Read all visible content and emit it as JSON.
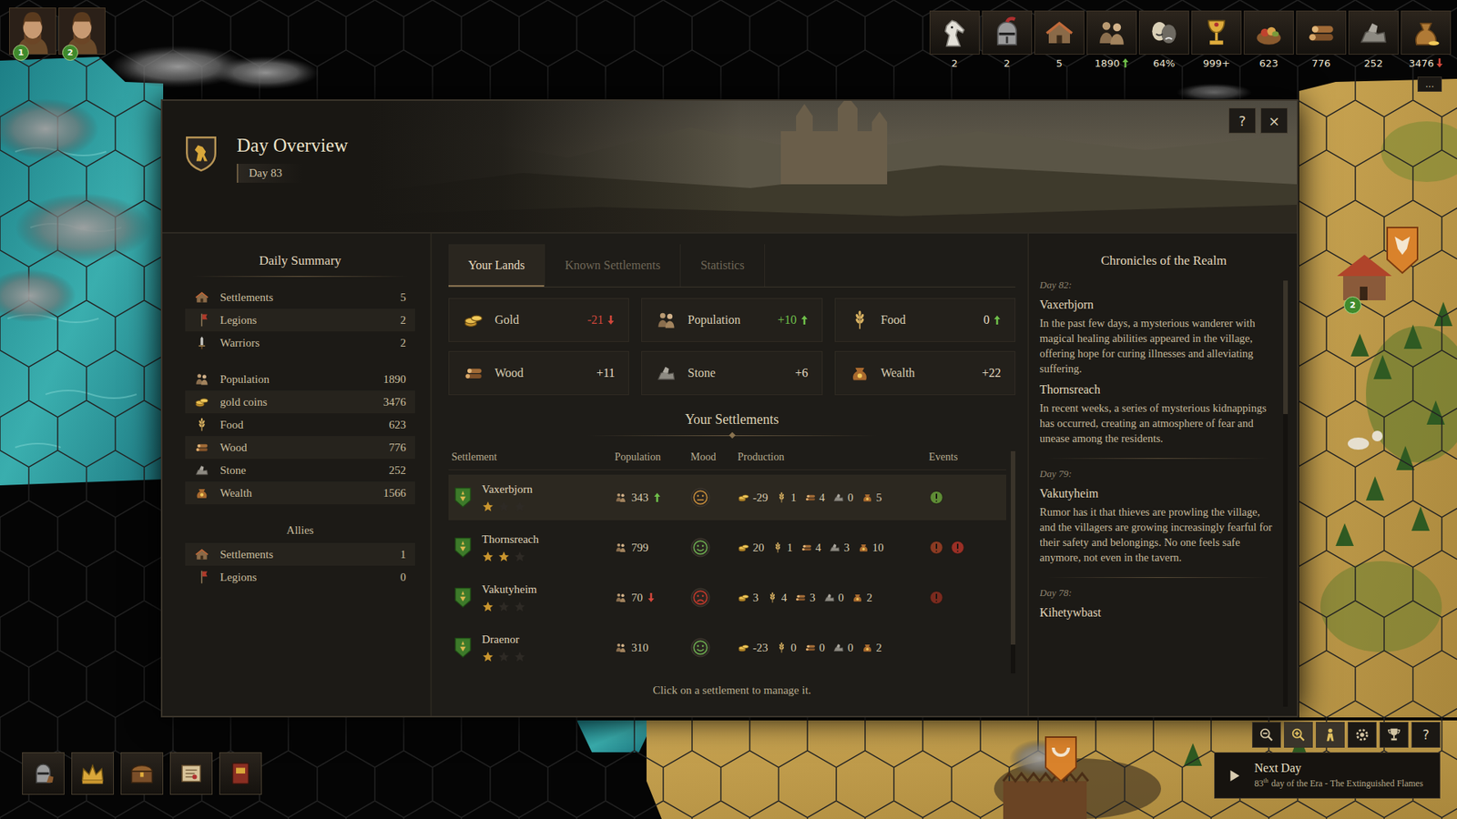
{
  "portraits": [
    {
      "badge": "1"
    },
    {
      "badge": "2"
    }
  ],
  "resources": [
    {
      "value": "2",
      "trend": "none"
    },
    {
      "value": "2",
      "trend": "none"
    },
    {
      "value": "5",
      "trend": "none"
    },
    {
      "value": "1890",
      "trend": "up"
    },
    {
      "value": "64%",
      "trend": "none"
    },
    {
      "value": "999+",
      "trend": "none"
    },
    {
      "value": "623",
      "trend": "none"
    },
    {
      "value": "776",
      "trend": "none"
    },
    {
      "value": "252",
      "trend": "none"
    },
    {
      "value": "3476",
      "trend": "down"
    }
  ],
  "resources_more": "...",
  "map": {
    "badge": "2"
  },
  "dialog": {
    "title": "Day Overview",
    "day": "Day 83",
    "help": "?",
    "close": "×"
  },
  "summary": {
    "title": "Daily Summary",
    "items": [
      {
        "label": "Settlements",
        "value": "5",
        "highlighted": false
      },
      {
        "label": "Legions",
        "value": "2",
        "highlighted": true
      },
      {
        "label": "Warriors",
        "value": "2",
        "highlighted": false
      },
      {
        "label": "Population",
        "value": "1890",
        "highlighted": false
      },
      {
        "label": "gold coins",
        "value": "3476",
        "highlighted": true
      },
      {
        "label": "Food",
        "value": "623",
        "highlighted": false
      },
      {
        "label": "Wood",
        "value": "776",
        "highlighted": true
      },
      {
        "label": "Stone",
        "value": "252",
        "highlighted": false
      },
      {
        "label": "Wealth",
        "value": "1566",
        "highlighted": true
      }
    ],
    "allies_title": "Allies",
    "allies": [
      {
        "label": "Settlements",
        "value": "1",
        "highlighted": true
      },
      {
        "label": "Legions",
        "value": "0",
        "highlighted": false
      }
    ]
  },
  "tabs": [
    {
      "label": "Your Lands",
      "selected": true
    },
    {
      "label": "Known Settlements",
      "selected": false
    },
    {
      "label": "Statistics",
      "selected": false
    }
  ],
  "stats": [
    {
      "label": "Gold",
      "value": "-21",
      "tone": "negative",
      "trend": "down"
    },
    {
      "label": "Population",
      "value": "+10",
      "tone": "positive",
      "trend": "up"
    },
    {
      "label": "Food",
      "value": "0",
      "tone": "neutral",
      "trend": "up"
    },
    {
      "label": "Wood",
      "value": "+11",
      "tone": "neutral",
      "trend": "none"
    },
    {
      "label": "Stone",
      "value": "+6",
      "tone": "neutral",
      "trend": "none"
    },
    {
      "label": "Wealth",
      "value": "+22",
      "tone": "neutral",
      "trend": "none"
    }
  ],
  "settlements": {
    "title": "Your Settlements",
    "columns": [
      "Settlement",
      "Population",
      "Mood",
      "Production",
      "Events"
    ],
    "rows": [
      {
        "name": "Vaxerbjorn",
        "stars": 1,
        "population": "343",
        "trend": "up",
        "mood": "neutral",
        "production": [
          "-29",
          "1",
          "4",
          "0",
          "5"
        ],
        "events": [
          {
            "color": "#5e8c35"
          }
        ],
        "selected": true
      },
      {
        "name": "Thornsreach",
        "stars": 2,
        "population": "799",
        "trend": "none",
        "mood": "happy",
        "production": [
          "20",
          "1",
          "4",
          "3",
          "10"
        ],
        "events": [
          {
            "color": "#8a3a22"
          },
          {
            "color": "#9a2f25"
          }
        ],
        "selected": false
      },
      {
        "name": "Vakutyheim",
        "stars": 1,
        "population": "70",
        "trend": "down",
        "mood": "unhappy",
        "production": [
          "3",
          "4",
          "3",
          "0",
          "2"
        ],
        "events": [
          {
            "color": "#7a2a1e"
          }
        ],
        "selected": false
      },
      {
        "name": "Draenor",
        "stars": 1,
        "population": "310",
        "trend": "none",
        "mood": "happy",
        "production": [
          "-23",
          "0",
          "0",
          "0",
          "2"
        ],
        "events": [],
        "selected": false
      }
    ],
    "scroll_level": 0.85,
    "footer": "Click on a settlement to manage it."
  },
  "chronicles": {
    "title": "Chronicles of the Realm",
    "scroll_level": 0.4,
    "days": [
      {
        "day": "Day 82:",
        "entries": [
          {
            "place": "Vaxerbjorn",
            "text": "In the past few days, a mysterious wanderer with magical healing abilities appeared in the village, offering hope for curing illnesses and alleviating suffering."
          },
          {
            "place": "Thornsreach",
            "text": "In recent weeks, a series of mysterious kidnappings has occurred, creating an atmosphere of fear and unease among the residents."
          }
        ]
      },
      {
        "day": "Day 79:",
        "entries": [
          {
            "place": "Vakutyheim",
            "text": "Rumor has it that thieves are prowling the village, and the villagers are growing increasingly fearful for their safety and belongings. No one feels safe anymore, not even in the tavern."
          }
        ]
      },
      {
        "day": "Day 78:",
        "entries": [
          {
            "place": "Kihetywbast"
          }
        ]
      }
    ]
  },
  "toolbar": [
    {
      "active": false
    },
    {
      "active": true
    },
    {
      "active": true
    },
    {
      "active": false
    },
    {
      "active": false
    }
  ],
  "toolbar_help": "?",
  "next_day": {
    "label": "Next Day",
    "day_number": "83",
    "day_suffix": "th",
    "subtitle": "day of the Era - The Extinguished Flames"
  }
}
